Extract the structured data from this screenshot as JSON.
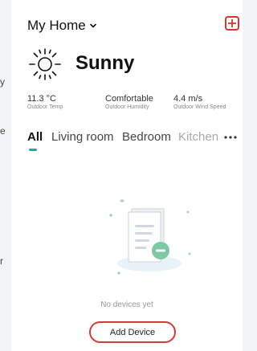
{
  "left_edge_fragments": [
    "y",
    "e",
    "r"
  ],
  "header": {
    "home_title": "My Home",
    "add_icon": "plus-square-icon",
    "accent_color": "#d8342e"
  },
  "weather": {
    "condition": "Sunny",
    "icon": "sun-icon",
    "stats": [
      {
        "value": "11.3 °C",
        "label": "Outdoor Temp"
      },
      {
        "value": "Comfortable",
        "label": "Outdoor Humidity"
      },
      {
        "value": "4.4 m/s",
        "label": "Outdoor Wind Speed"
      }
    ]
  },
  "tabs": {
    "items": [
      "All",
      "Living room",
      "Bedroom",
      "Kitchen"
    ],
    "active": "All",
    "indicator_color": "#26a69a",
    "more_icon": "more-horizontal-icon"
  },
  "empty_state": {
    "message": "No devices yet",
    "button_label": "Add Device"
  }
}
